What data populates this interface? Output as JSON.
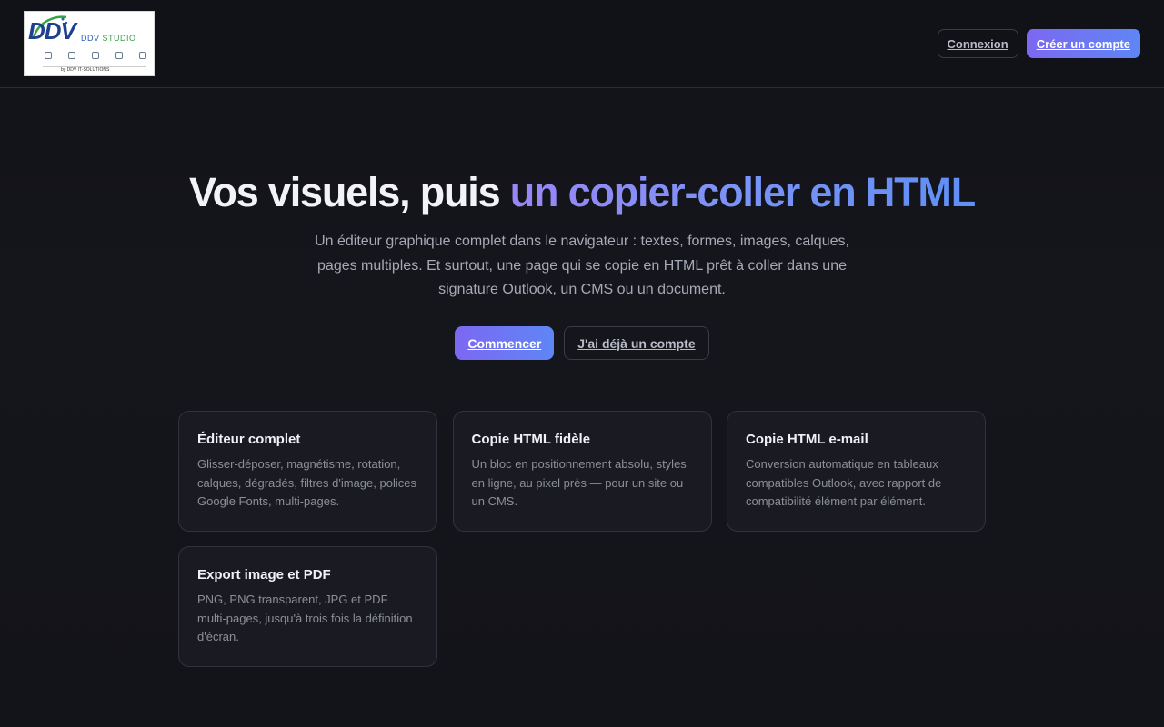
{
  "header": {
    "logo": {
      "main": "DDV",
      "studio_prefix": "DDV ",
      "studio": "STUDIO",
      "by": "by DDV IT-SOLUTIONS"
    },
    "login_label": "Connexion",
    "signup_label": "Créer un compte"
  },
  "hero": {
    "title_plain": "Vos visuels, puis ",
    "title_accent": "un copier-coller en HTML",
    "subtitle": "Un éditeur graphique complet dans le navigateur : textes, formes, images, calques, pages multiples. Et surtout, une page qui se copie en HTML prêt à coller dans une signature Outlook, un CMS ou un document.",
    "cta_primary": "Commencer",
    "cta_secondary": "J'ai déjà un compte"
  },
  "features": [
    {
      "title": "Éditeur complet",
      "description": "Glisser-déposer, magnétisme, rotation, calques, dégradés, filtres d'image, polices Google Fonts, multi-pages."
    },
    {
      "title": "Copie HTML fidèle",
      "description": "Un bloc en positionnement absolu, styles en ligne, au pixel près — pour un site ou un CMS."
    },
    {
      "title": "Copie HTML e-mail",
      "description": "Conversion automatique en tableaux compatibles Outlook, avec rapport de compatibilité élément par élément."
    },
    {
      "title": "Export image et PDF",
      "description": "PNG, PNG transparent, JPG et PDF multi-pages, jusqu'à trois fois la définition d'écran."
    }
  ],
  "colors": {
    "background": "#121318",
    "accent_start": "#7c68f2",
    "accent_end": "#5f86f5",
    "card_bg": "#1a1b22"
  }
}
